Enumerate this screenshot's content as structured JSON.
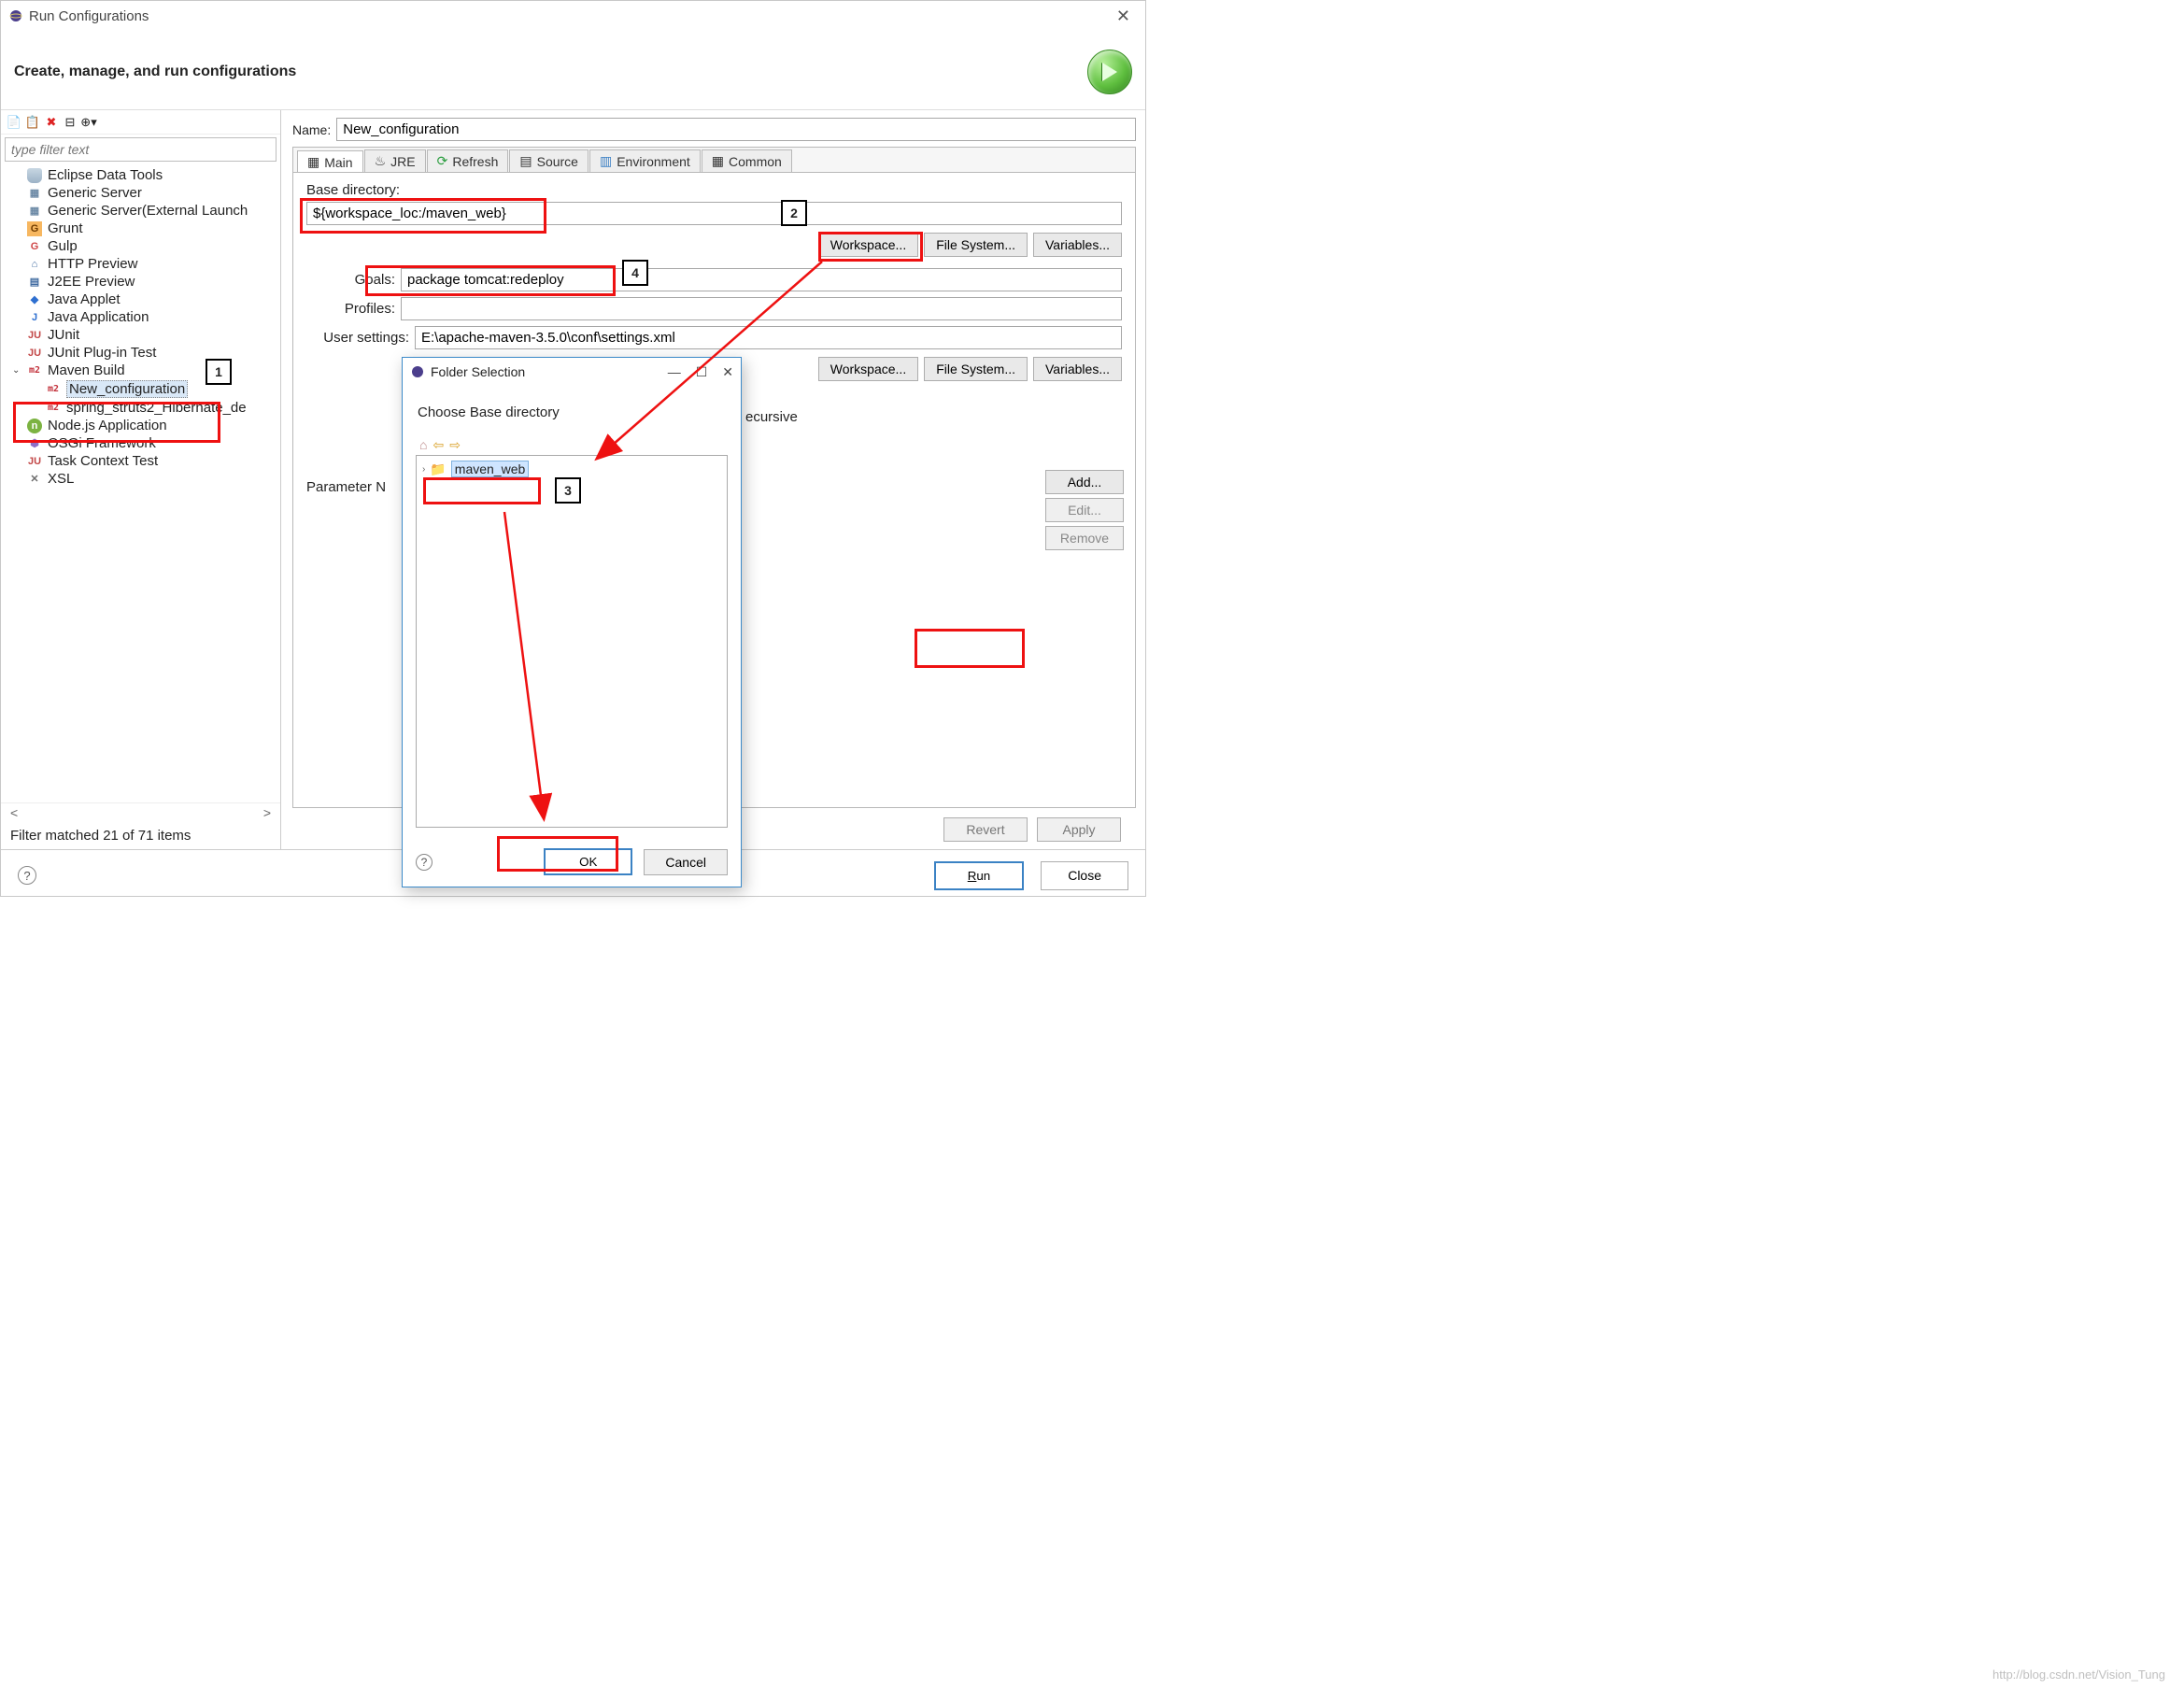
{
  "window": {
    "title": "Run Configurations",
    "header": "Create, manage, and run configurations"
  },
  "leftPanel": {
    "filter_placeholder": "type filter text",
    "filter_match": "Filter matched 21 of 71 items",
    "items": {
      "eclipse_data_tools": "Eclipse Data Tools",
      "generic_server": "Generic Server",
      "generic_server_ext": "Generic Server(External Launch",
      "grunt": "Grunt",
      "gulp": "Gulp",
      "http_preview": "HTTP Preview",
      "j2ee_preview": "J2EE Preview",
      "java_applet": "Java Applet",
      "java_application": "Java Application",
      "junit": "JUnit",
      "junit_plugin": "JUnit Plug-in Test",
      "maven_build": "Maven Build",
      "new_configuration": "New_configuration",
      "spring_struts2": "spring_struts2_Hibernate_de",
      "node_app": "Node.js Application",
      "osgi": "OSGi Framework",
      "task_context": "Task Context Test",
      "xsl": "XSL"
    }
  },
  "rightPanel": {
    "name_label": "Name:",
    "name_value": "New_configuration",
    "tabs": {
      "main": "Main",
      "jre": "JRE",
      "refresh": "Refresh",
      "source": "Source",
      "environment": "Environment",
      "common": "Common"
    },
    "base_dir_label": "Base directory:",
    "base_dir_value": "${workspace_loc:/maven_web}",
    "workspace_btn": "Workspace...",
    "filesystem_btn": "File System...",
    "variables_btn": "Variables...",
    "goals_label": "Goals:",
    "goals_value": "package tomcat:redeploy",
    "profiles_label": "Profiles:",
    "profiles_value": "",
    "user_settings_label": "User settings:",
    "user_settings_value": "E:\\apache-maven-3.5.0\\conf\\settings.xml",
    "recursive_text": "ecursive",
    "param_name_label": "Parameter N",
    "side": {
      "add": "Add...",
      "edit": "Edit...",
      "remove": "Remove"
    },
    "revert": "Revert",
    "apply": "Apply"
  },
  "bottom": {
    "run": "Run",
    "close": "Close"
  },
  "dialog": {
    "title": "Folder Selection",
    "message": "Choose Base directory",
    "tree_item": "maven_web",
    "ok": "OK",
    "cancel": "Cancel"
  },
  "callouts": {
    "c1": "1",
    "c2": "2",
    "c3": "3",
    "c4": "4"
  },
  "watermark": "http://blog.csdn.net/Vision_Tung"
}
